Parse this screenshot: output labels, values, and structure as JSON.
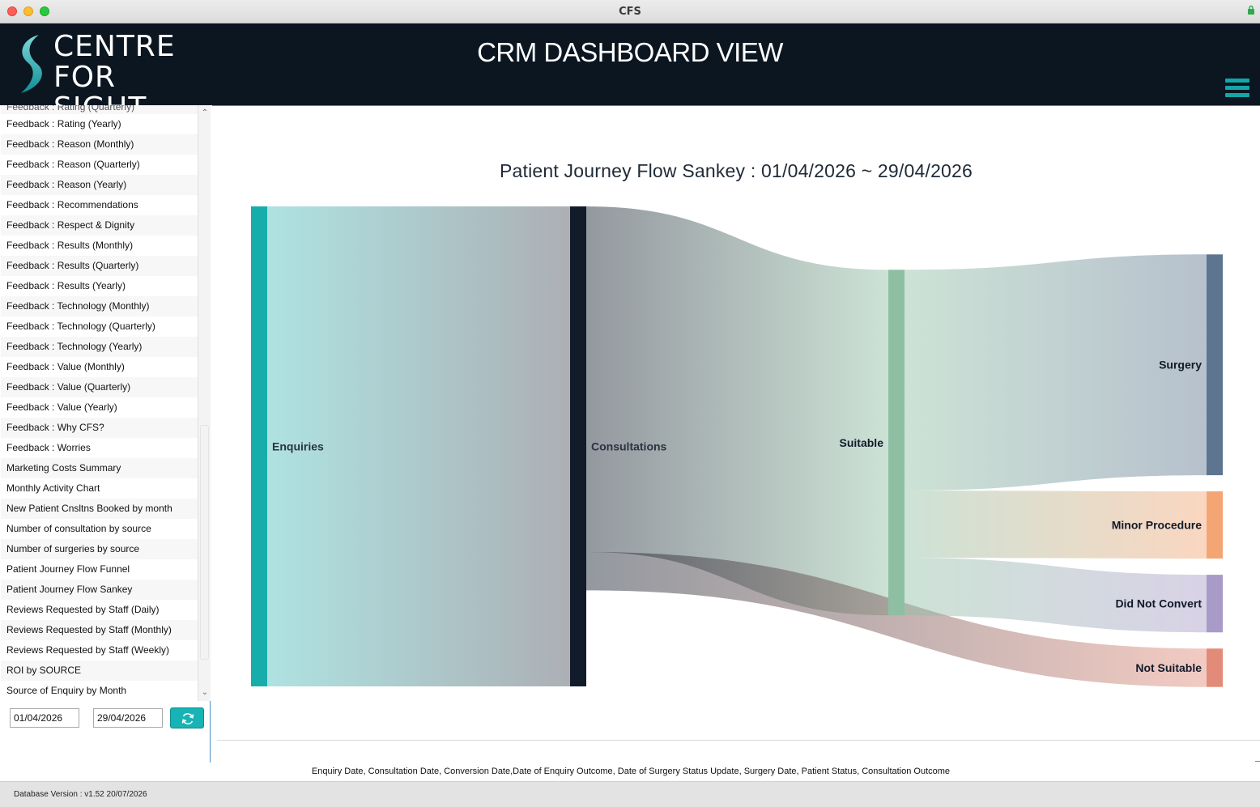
{
  "window": {
    "title": "CFS"
  },
  "header": {
    "logo_line1": "CENTRE",
    "logo_line2": "FOR SIGHT",
    "title": "CRM DASHBOARD VIEW",
    "menu_icon": "hamburger-menu-icon",
    "accent_color": "#14a6a8",
    "background_color": "#0b1621"
  },
  "sidebar": {
    "partial_item": "Feedback : Rating (Quarterly)",
    "items": [
      "Feedback : Rating (Yearly)",
      "Feedback : Reason (Monthly)",
      "Feedback : Reason (Quarterly)",
      "Feedback : Reason (Yearly)",
      "Feedback : Recommendations",
      "Feedback : Respect & Dignity",
      "Feedback : Results (Monthly)",
      "Feedback : Results (Quarterly)",
      "Feedback : Results (Yearly)",
      "Feedback : Technology (Monthly)",
      "Feedback : Technology (Quarterly)",
      "Feedback : Technology (Yearly)",
      "Feedback : Value (Monthly)",
      "Feedback : Value (Quarterly)",
      "Feedback : Value (Yearly)",
      "Feedback : Why CFS?",
      "Feedback : Worries",
      "Marketing Costs Summary",
      "Monthly Activity Chart",
      "New Patient Cnsltns Booked by month",
      "Number of consultation by source",
      "Number of surgeries by source",
      "Patient Journey Flow Funnel",
      "Patient Journey Flow Sankey",
      "Reviews Requested by Staff (Daily)",
      "Reviews Requested by Staff (Monthly)",
      "Reviews Requested by Staff (Weekly)",
      "ROI by SOURCE",
      "Source of Enquiry by Month"
    ],
    "date_from": "01/04/2026",
    "date_to": "29/04/2026",
    "refresh_icon": "refresh-icon"
  },
  "chart_data": {
    "type": "sankey",
    "title": "Patient Journey Flow Sankey : 01/04/2026 ~ 29/04/2026",
    "nodes": [
      {
        "name": "Enquiries",
        "color": "#17adab"
      },
      {
        "name": "Consultations",
        "color": "#111b2a"
      },
      {
        "name": "Suitable",
        "color": "#8fbfa3"
      },
      {
        "name": "Surgery",
        "color": "#5e7590"
      },
      {
        "name": "Minor Procedure",
        "color": "#f4a574"
      },
      {
        "name": "Did Not Convert",
        "color": "#a99bc8"
      },
      {
        "name": "Not Suitable",
        "color": "#e28b78"
      }
    ],
    "links": [
      {
        "source": "Enquiries",
        "target": "Consultations",
        "value": 100
      },
      {
        "source": "Consultations",
        "target": "Suitable",
        "value": 72
      },
      {
        "source": "Consultations",
        "target": "Not Suitable",
        "value": 8
      },
      {
        "source": "Suitable",
        "target": "Surgery",
        "value": 46
      },
      {
        "source": "Suitable",
        "target": "Minor Procedure",
        "value": 14
      },
      {
        "source": "Suitable",
        "target": "Did Not Convert",
        "value": 12
      }
    ]
  },
  "footer": {
    "fields": "Enquiry Date, Consultation Date, Conversion Date,Date of Enquiry Outcome, Date of Surgery Status Update, Surgery Date,  Patient Status, Consultation Outcome",
    "db_version": "Database Version : v1.52 20/07/2026"
  }
}
